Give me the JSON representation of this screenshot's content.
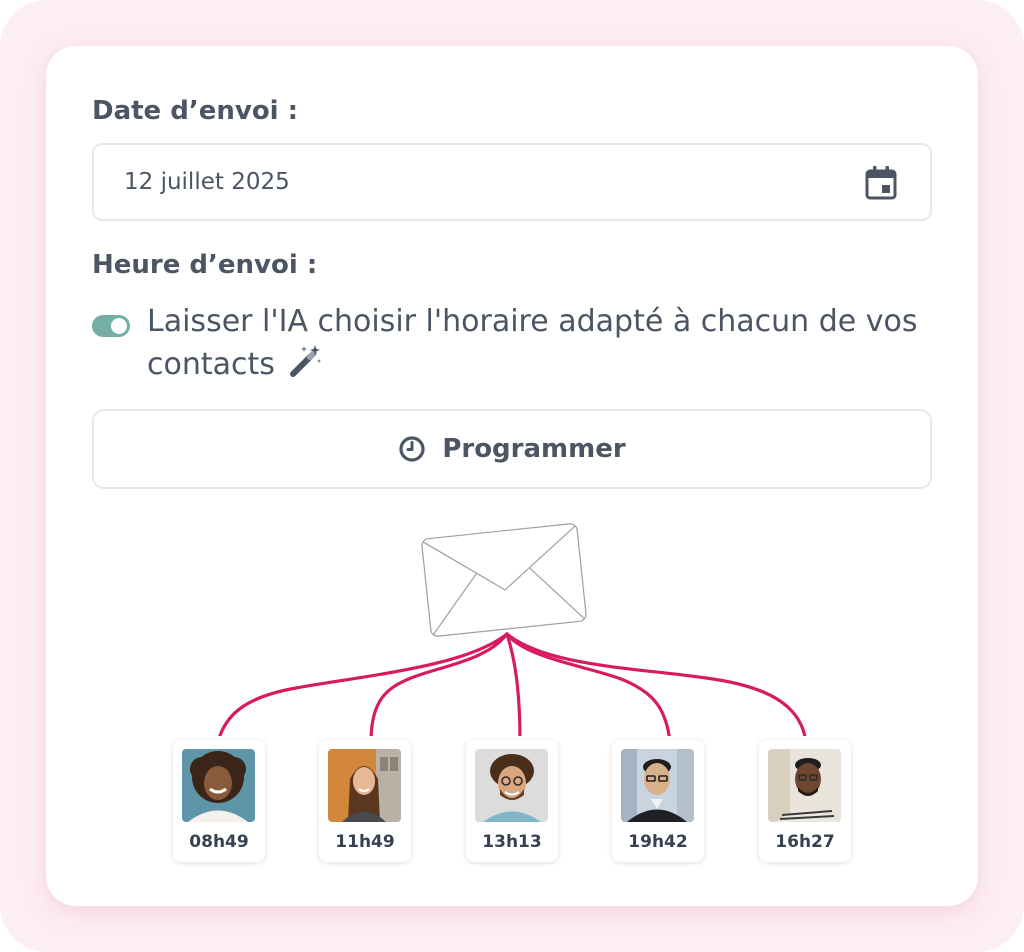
{
  "form": {
    "date_label": "Date d’envoi :",
    "date_value": "12 juillet 2025",
    "time_label": "Heure d’envoi :",
    "ai_toggle": {
      "on": true,
      "text": "Laisser l'IA choisir l'horaire adapté à chacun de vos contacts"
    },
    "schedule_button_label": "Programmer"
  },
  "icons": {
    "calendar": "calendar-icon",
    "wand": "magic-wand-icon",
    "clock": "clock-icon",
    "envelope": "envelope-icon"
  },
  "colors": {
    "accent_arrow": "#d81b60",
    "toggle_on": "#74aea4",
    "text": "#4b5563",
    "frame_background": "#fdeef2"
  },
  "contacts": [
    {
      "time": "08h49"
    },
    {
      "time": "11h49"
    },
    {
      "time": "13h13"
    },
    {
      "time": "19h42"
    },
    {
      "time": "16h27"
    }
  ]
}
